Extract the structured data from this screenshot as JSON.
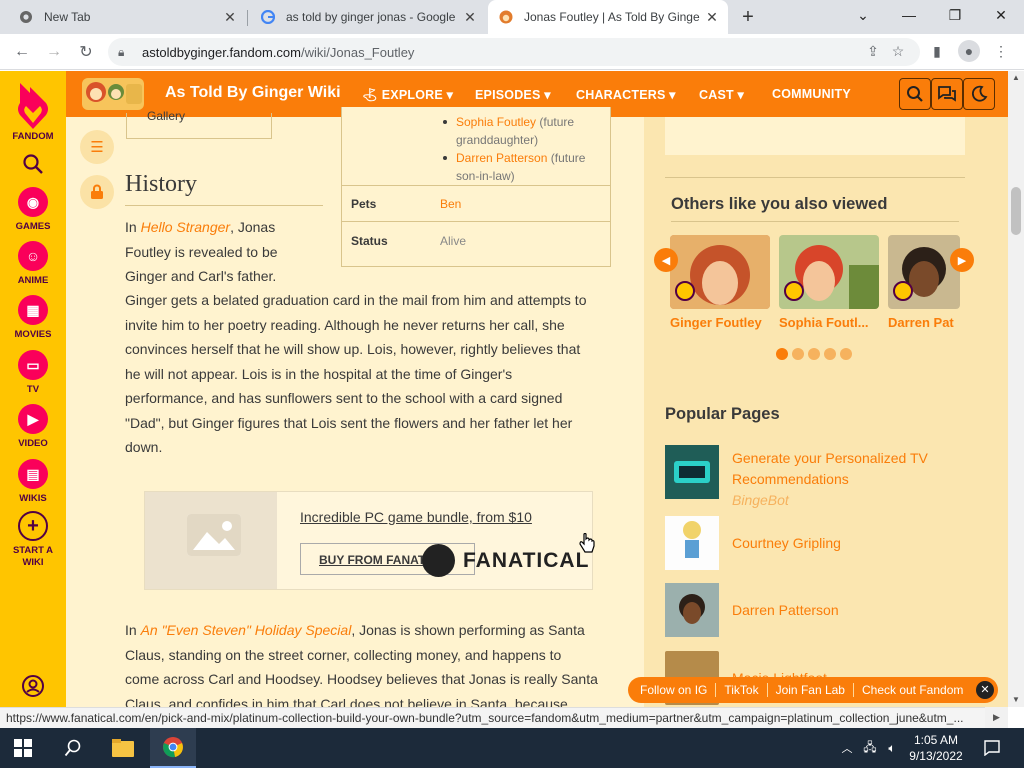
{
  "browser": {
    "tabs": [
      {
        "title": "New Tab",
        "active": false
      },
      {
        "title": "as told by ginger jonas - Google",
        "active": false
      },
      {
        "title": "Jonas Foutley | As Told By Ginger",
        "active": true
      }
    ],
    "new_tab": "+",
    "address": {
      "domain": "astoldbyginger.fandom.com",
      "path": "/wiki/Jonas_Foutley"
    },
    "status_url": "https://www.fanatical.com/en/pick-and-mix/platinum-collection-build-your-own-bundle?utm_source=fandom&utm_medium=partner&utm_campaign=platinum_collection_june&utm_..."
  },
  "fandom_sidebar": {
    "brand": "FANDOM",
    "items": [
      {
        "label": "GAMES",
        "icon": "gamepad-icon"
      },
      {
        "label": "ANIME",
        "icon": "anime-icon"
      },
      {
        "label": "MOVIES",
        "icon": "clapperboard-icon"
      },
      {
        "label": "TV",
        "icon": "tv-icon"
      },
      {
        "label": "VIDEO",
        "icon": "play-icon"
      },
      {
        "label": "WIKIS",
        "icon": "book-icon"
      },
      {
        "label": "START A WIKI",
        "icon": "plus-circle-icon"
      }
    ]
  },
  "wiki_header": {
    "title": "As Told By Ginger Wiki",
    "nav": [
      "EXPLORE",
      "EPISODES",
      "CHARACTERS",
      "CAST",
      "COMMUNITY"
    ]
  },
  "article": {
    "toc_fragment": "Gallery",
    "heading": "History",
    "infobox": {
      "relatives": [
        {
          "name": "Sophia Foutley",
          "note": "(future granddaughter)"
        },
        {
          "name": "Darren Patterson",
          "note": "(future son-in-law)"
        }
      ],
      "rows": [
        {
          "key": "Pets",
          "value": "Ben",
          "link": true
        },
        {
          "key": "Status",
          "value": "Alive",
          "link": false
        }
      ]
    },
    "p1_prefix": "In",
    "p1_link": "Hello Stranger",
    "p1_line1": ", Jonas",
    "p1_line2": "Foutley is revealed to be",
    "p1_line3": "Ginger and Carl's father.",
    "p2_lines": [
      "Ginger gets a belated graduation card in the mail from him and attempts to",
      "invite him to her poetry reading. Although he never returns her call, she",
      "convinces herself that he will show up. Lois, however, rightly believes that",
      "he will not appear. Lois is in the hospital at the time of Ginger's",
      "performance, and has sunflowers sent to the school with a card signed",
      "\"Dad\", but Ginger figures that Lois sent the flowers and her father let her",
      "down."
    ],
    "p3_prefix": "In",
    "p3_link": "An \"Even Steven\" Holiday Special",
    "p3_line1": ", Jonas is shown performing as Santa",
    "p3_lines": [
      "Claus, standing on the street corner, collecting money, and happens to",
      "come across Carl and Hoodsey. Hoodsey believes that Jonas is really Santa",
      "Claus, and confides in him that Carl does not believe in Santa, because"
    ]
  },
  "ad": {
    "link": "Incredible PC game bundle, from $10",
    "button": "BUY FROM FANATICAL",
    "brand": "FANATICAL"
  },
  "rail": {
    "others_title": "Others like you also viewed",
    "cards": [
      "Ginger Foutley",
      "Sophia Foutl...",
      "Darren Pat"
    ],
    "popular_title": "Popular Pages",
    "popular": [
      {
        "title_line1": "Generate your Personalized TV",
        "title_line2": "Recommendations",
        "sub": "BingeBot"
      },
      {
        "title_line1": "Courtney Gripling"
      },
      {
        "title_line1": "Darren Patterson"
      },
      {
        "title_line1": "Macie Lightfoot"
      }
    ]
  },
  "footer_bar": [
    "Follow on IG",
    "TikTok",
    "Join Fan Lab",
    "Check out Fandom"
  ],
  "taskbar": {
    "time": "1:05 AM",
    "date": "9/13/2022"
  },
  "colors": {
    "fandom_orange": "#fa7d0a",
    "fandom_yellow": "#ffc500",
    "page_bg": "#fbe6b0"
  }
}
